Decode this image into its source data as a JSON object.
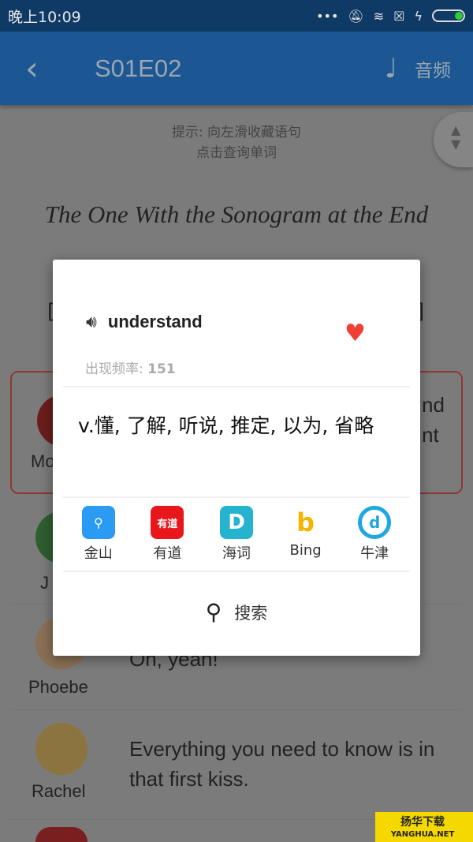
{
  "status_bar": {
    "time": "晚上10:09",
    "icons": [
      "more-dots-icon",
      "mute-icon",
      "wifi-icon",
      "no-sim-icon",
      "charging-icon",
      "battery-icon"
    ]
  },
  "app_bar": {
    "back_icon": "chevron-left-icon",
    "title": "S01E02",
    "audio_icon": "music-note-icon",
    "audio_label": "音频"
  },
  "hint": {
    "line1": "提示: 向左滑收藏语句",
    "line2": "点击查询单词"
  },
  "episode_title": "The One With the Sonogram at the End",
  "brackets": {
    "left": "[",
    "right": "]"
  },
  "dialogue": [
    {
      "speaker": "Mo",
      "text_fragments": [
        "nd",
        "nt"
      ],
      "highlighted": true
    },
    {
      "speaker": "J",
      "text": ""
    },
    {
      "speaker": "Phoebe",
      "text": "Oh, yeah!"
    },
    {
      "speaker": "Rachel",
      "text": "Everything you need to know is in that first kiss."
    }
  ],
  "dialog": {
    "speaker_icon": "speaker-icon",
    "word": "understand",
    "favorite_icon": "heart-icon",
    "favorite_color": "#ee4136",
    "frequency_label": "出现频率:",
    "frequency_value": "151",
    "definition": "v.懂, 了解, 听说, 推定, 以为, 省略",
    "dictionaries": [
      {
        "label": "金山",
        "icon": "jinshan-icon",
        "color": "#2b9af3"
      },
      {
        "label": "有道",
        "icon": "youdao-icon",
        "color": "#e8171c",
        "glyph": "有道"
      },
      {
        "label": "海词",
        "icon": "haici-icon",
        "color": "#26b3cf",
        "glyph": "D"
      },
      {
        "label": "Bing",
        "icon": "bing-icon",
        "color": "#f5b400",
        "glyph": "b"
      },
      {
        "label": "牛津",
        "icon": "oxford-icon",
        "color": "#1ea7e1",
        "glyph": "d"
      }
    ],
    "search_icon": "search-icon",
    "search_label": "搜索"
  },
  "watermark": {
    "line1": "扬华下载",
    "line2": "YANGHUA.NET"
  }
}
